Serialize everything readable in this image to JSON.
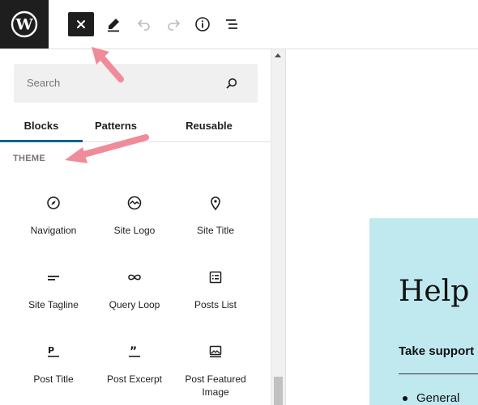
{
  "toolbar": {
    "logo_icon": "wordpress-logo",
    "close_icon": "close-icon",
    "edit_icon": "pencil-icon",
    "undo_icon": "undo-icon",
    "redo_icon": "redo-icon",
    "info_icon": "info-icon",
    "list_view_icon": "list-view-icon"
  },
  "inserter": {
    "search": {
      "placeholder": "Search",
      "icon": "search-icon"
    },
    "tabs": [
      {
        "label": "Blocks",
        "active": true
      },
      {
        "label": "Patterns",
        "active": false
      },
      {
        "label": "Reusable",
        "active": false
      }
    ],
    "section_title": "THEME",
    "blocks": [
      {
        "label": "Navigation",
        "icon": "navigation-icon"
      },
      {
        "label": "Site Logo",
        "icon": "site-logo-icon"
      },
      {
        "label": "Site Title",
        "icon": "site-title-icon"
      },
      {
        "label": "Site Tagline",
        "icon": "site-tagline-icon"
      },
      {
        "label": "Query Loop",
        "icon": "query-loop-icon"
      },
      {
        "label": "Posts List",
        "icon": "posts-list-icon"
      },
      {
        "label": "Post Title",
        "icon": "post-title-icon"
      },
      {
        "label": "Post Excerpt",
        "icon": "post-excerpt-icon"
      },
      {
        "label": "Post Featured Image",
        "icon": "post-featured-image-icon"
      }
    ]
  },
  "canvas": {
    "heading": "Help C",
    "subheading": "Take support",
    "list_item": "General"
  },
  "colors": {
    "dark": "#1e1e1e",
    "accent": "#00648d",
    "canvas_bg": "#bfe8ef",
    "annotation_arrow": "#f08c9a"
  }
}
